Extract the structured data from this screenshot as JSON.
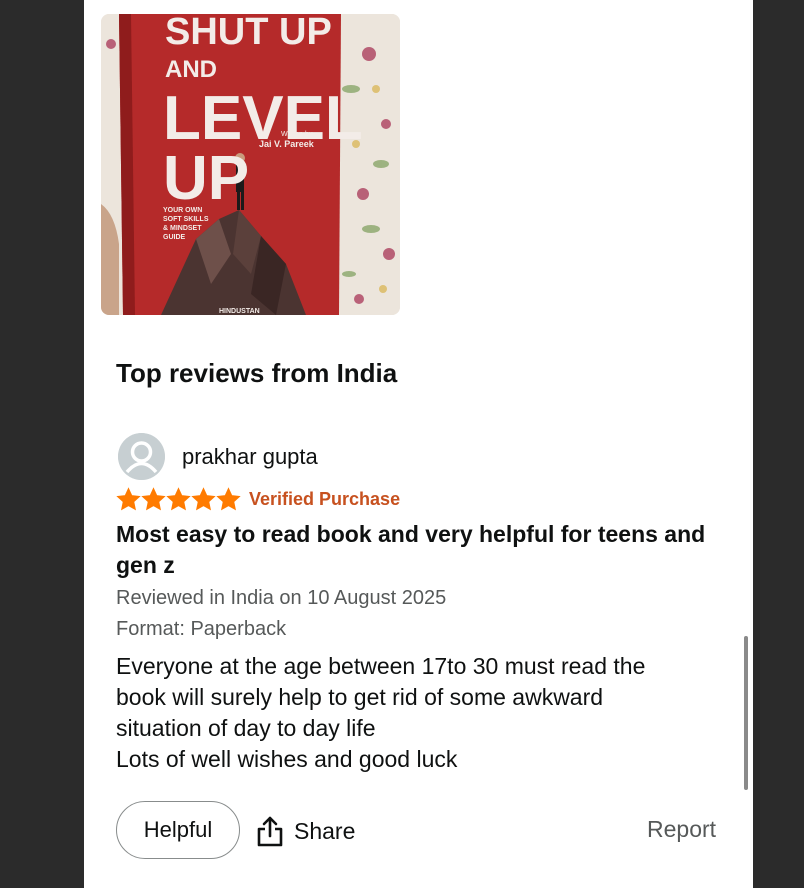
{
  "product_image": {
    "title_lines": [
      "SHUT UP",
      "AND",
      "LEVEL",
      "UP"
    ],
    "written_by": "Written by",
    "author": "Jai V. Pareek",
    "subtitle_lines": [
      "YOUR OWN",
      "SOFT SKILLS",
      "& MINDSET",
      "GUIDE"
    ],
    "publisher": "HINDUSTAN"
  },
  "reviews_section": {
    "title": "Top reviews from India"
  },
  "review": {
    "reviewer": "prakhar gupta",
    "rating": 5,
    "rating_max": 5,
    "star_color": "#ff7b00",
    "badge": "Verified Purchase",
    "badge_color": "#c7511f",
    "title": "Most easy to read book and very helpful for teens and gen z",
    "date_line": "Reviewed in India on 10 August 2025",
    "format_line": "Format: Paperback",
    "body_lines": [
      "Everyone at the age between 17to 30 must read the",
      "book will surely help to get rid of some awkward",
      "situation of day to day life",
      "Lots of well wishes and good luck"
    ]
  },
  "actions": {
    "helpful_label": "Helpful",
    "share_label": "Share",
    "share_icon": "share-icon",
    "report_label": "Report"
  }
}
